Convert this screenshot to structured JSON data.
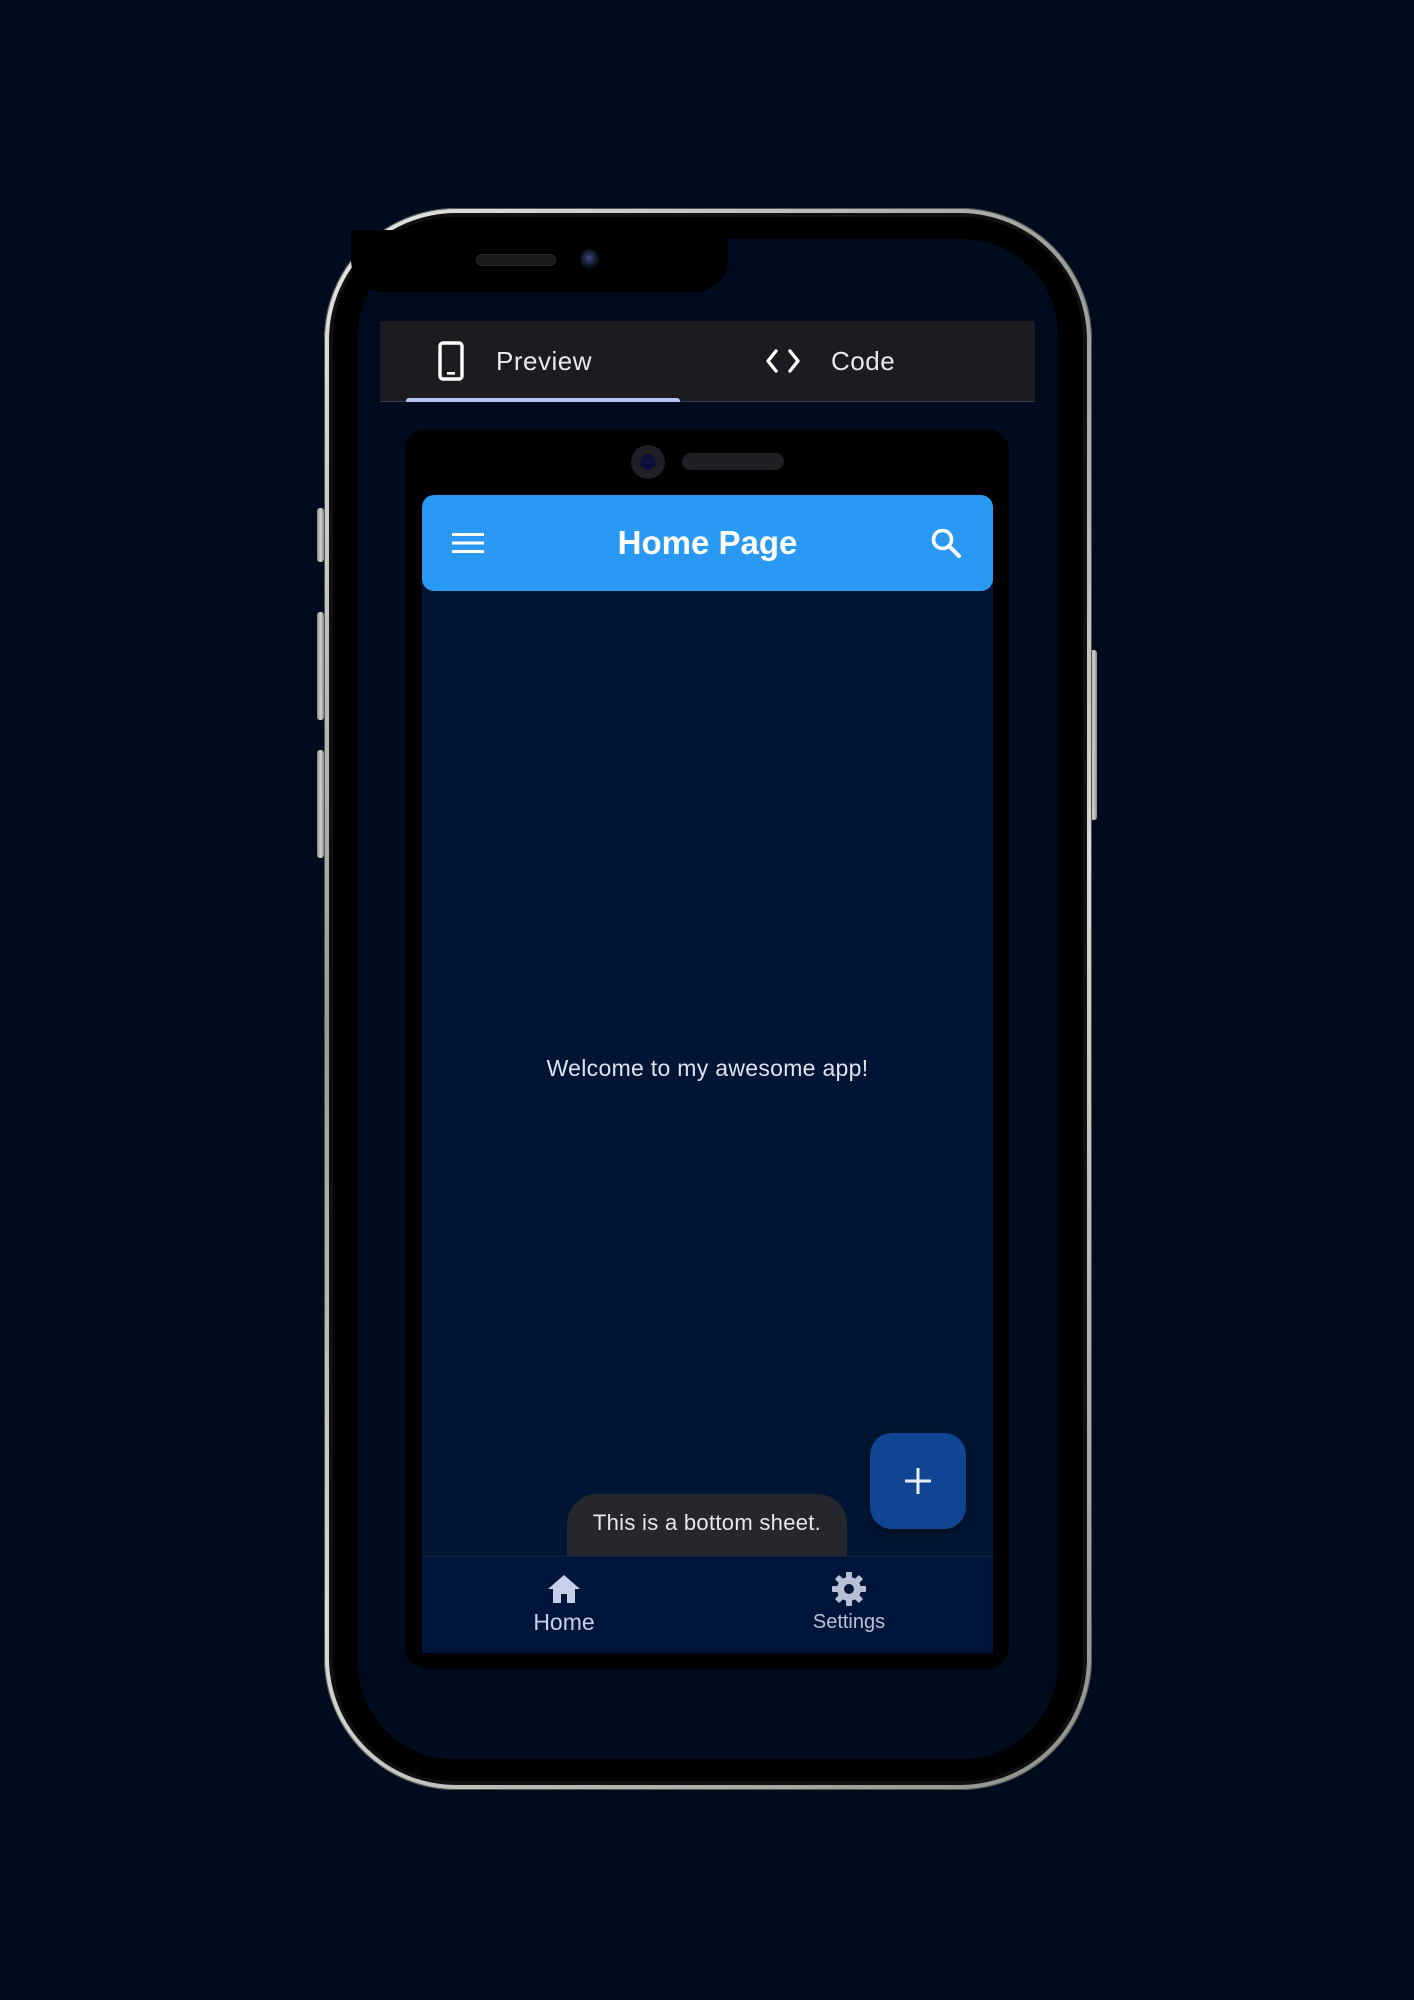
{
  "tabs": [
    {
      "label": "Preview",
      "icon": "smartphone-icon",
      "selected": true
    },
    {
      "label": "Code",
      "icon": "code-icon",
      "selected": false
    }
  ],
  "app": {
    "title": "Home Page",
    "menu_icon": "menu-icon",
    "search_icon": "search-icon",
    "body_text": "Welcome to my awesome app!",
    "fab_icon": "add-icon",
    "bottom_sheet_text": "This is a bottom sheet.",
    "nav_items": [
      {
        "label": "Home",
        "icon": "home-icon",
        "selected": true
      },
      {
        "label": "Settings",
        "icon": "settings-icon",
        "selected": false
      }
    ]
  },
  "colors": {
    "page_background": "#000b1d",
    "app_bar": "#2a99f3",
    "app_background": "#001533",
    "fab": "#0f4592",
    "tab_indicator": "#b4c4f4",
    "bottom_sheet": "#26272c"
  }
}
